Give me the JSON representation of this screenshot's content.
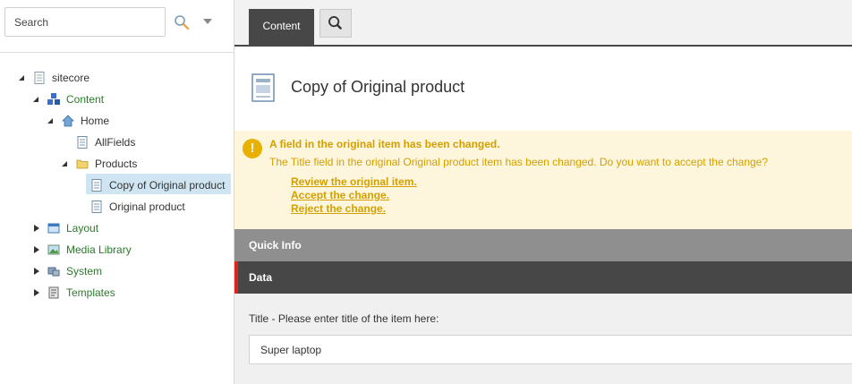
{
  "search": {
    "placeholder": "Search"
  },
  "tree": {
    "sitecore": "sitecore",
    "content": "Content",
    "home": "Home",
    "allfields": "AllFields",
    "products": "Products",
    "copy_of_original": "Copy of Original product",
    "original_product": "Original product",
    "layout": "Layout",
    "media_library": "Media Library",
    "system": "System",
    "templates": "Templates"
  },
  "toolbar": {
    "content_tab": "Content",
    "search_icon": "search-icon"
  },
  "item": {
    "title": "Copy of Original product"
  },
  "warning": {
    "title": "A field in the original item has been changed.",
    "text": "The Title field in the original Original product item has been changed. Do you want to accept the change?",
    "review": "Review the original item.",
    "accept": "Accept the change.",
    "reject": "Reject the change."
  },
  "sections": {
    "quick_info": "Quick Info",
    "data": "Data"
  },
  "field": {
    "label": "Title - Please enter title of the item here:",
    "value": "Super laptop"
  },
  "colors": {
    "tree_green": "#2a7a2a",
    "warning_text": "#d4a000",
    "warning_bg": "#fdf5dc",
    "selected": "#cfe5f2",
    "accent_red": "#d9251d",
    "dark_bar": "#474747"
  }
}
